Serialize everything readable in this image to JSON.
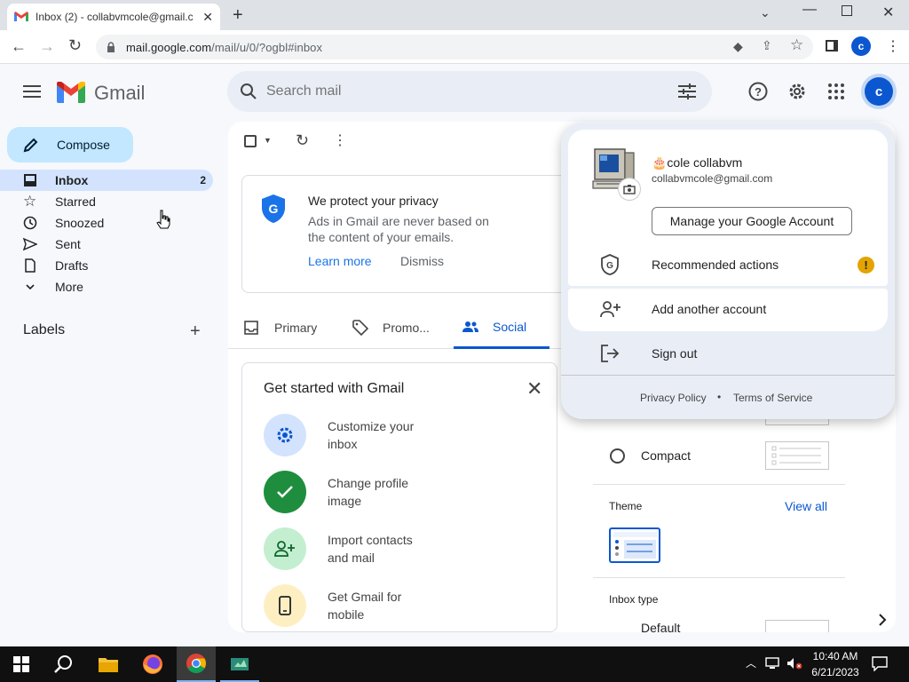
{
  "browser": {
    "tab_title": "Inbox (2) - collabvmcole@gmail.c",
    "url_host": "mail.google.com",
    "url_path": "/mail/u/0/?ogbl#inbox",
    "profile_initial": "c"
  },
  "gmail": {
    "logo_text": "Gmail",
    "search_placeholder": "Search mail",
    "account_initial": "c"
  },
  "sidebar": {
    "compose_label": "Compose",
    "items": [
      {
        "label": "Inbox",
        "count": "2",
        "active": true
      },
      {
        "label": "Starred"
      },
      {
        "label": "Snoozed"
      },
      {
        "label": "Sent"
      },
      {
        "label": "Drafts"
      },
      {
        "label": "More"
      }
    ],
    "labels_heading": "Labels"
  },
  "privacy_card": {
    "title": "We protect your privacy",
    "body_line1": "Ads in Gmail are never based on",
    "body_line2": "the content of your emails.",
    "learn_more": "Learn more",
    "dismiss": "Dismiss"
  },
  "inbox_tabs": [
    {
      "label": "Primary"
    },
    {
      "label": "Promo..."
    },
    {
      "label": "Social",
      "active": true
    }
  ],
  "get_started": {
    "title": "Get started with Gmail",
    "items": [
      {
        "line1": "Customize your",
        "line2": "inbox"
      },
      {
        "line1": "Change profile",
        "line2": "image"
      },
      {
        "line1": "Import contacts",
        "line2": "and mail"
      },
      {
        "line1": "Get Gmail for",
        "line2": "mobile"
      }
    ]
  },
  "settings_panel": {
    "density_option": "Compact",
    "theme_heading": "Theme",
    "view_all": "View all",
    "inbox_type_heading": "Inbox type",
    "inbox_type_value": "Default"
  },
  "account_popup": {
    "name": "🎂cole collabvm",
    "email": "collabvmcole@gmail.com",
    "manage_button": "Manage your Google Account",
    "recommended": "Recommended actions",
    "add_account": "Add another account",
    "sign_out": "Sign out",
    "privacy_policy": "Privacy Policy",
    "separator": "•",
    "terms": "Terms of Service"
  },
  "taskbar": {
    "time": "10:40 AM",
    "date": "6/21/2023"
  },
  "colors": {
    "accent_blue": "#0b57d0",
    "compose_bg": "#c2e7ff",
    "active_nav": "#d3e3fd",
    "warning": "#e3a300",
    "check_green": "#1e8e3e"
  }
}
